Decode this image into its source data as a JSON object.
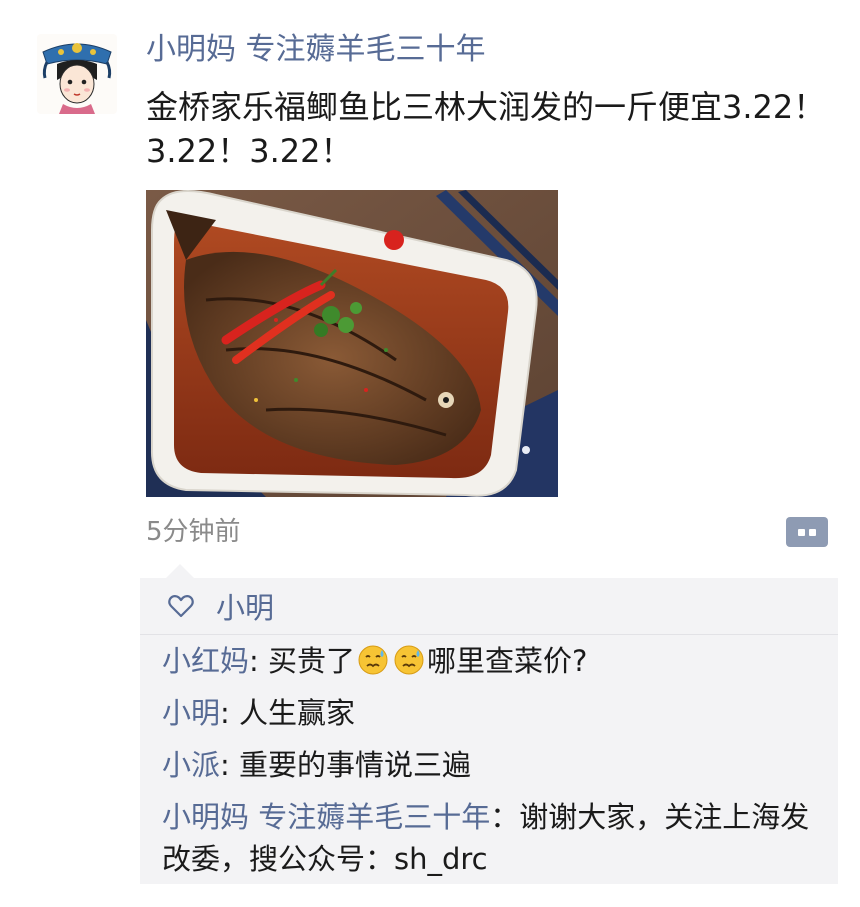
{
  "post": {
    "author": "小明妈 专注薅羊毛三十年",
    "text": "金桥家乐福鲫鱼比三林大润发的一斤便宜3.22！3.22！3.22！",
    "image_icon": "braised-fish-photo",
    "timestamp": "5分钟前"
  },
  "interactions": {
    "like_icon": "heart-outline-icon",
    "likes": [
      "小明"
    ],
    "comments": [
      {
        "name": "小红妈",
        "sep": ": ",
        "pre": "买贵了",
        "emojis": [
          "sweat-face-emoji",
          "sweat-face-emoji"
        ],
        "post": "哪里查菜价?"
      },
      {
        "name": "小明",
        "sep": ": ",
        "pre": "人生赢家",
        "emojis": [],
        "post": ""
      },
      {
        "name": "小派",
        "sep": ": ",
        "pre": "重要的事情说三遍",
        "emojis": [],
        "post": ""
      },
      {
        "name": "小明妈 专注薅羊毛三十年",
        "sep": "：",
        "pre": "谢谢大家，关注上海发改委，搜公众号：sh_drc",
        "emojis": [],
        "post": ""
      }
    ]
  },
  "colors": {
    "name_link": "#576b95",
    "panel_bg": "#f3f3f5",
    "timestamp": "#8a8a8a"
  }
}
